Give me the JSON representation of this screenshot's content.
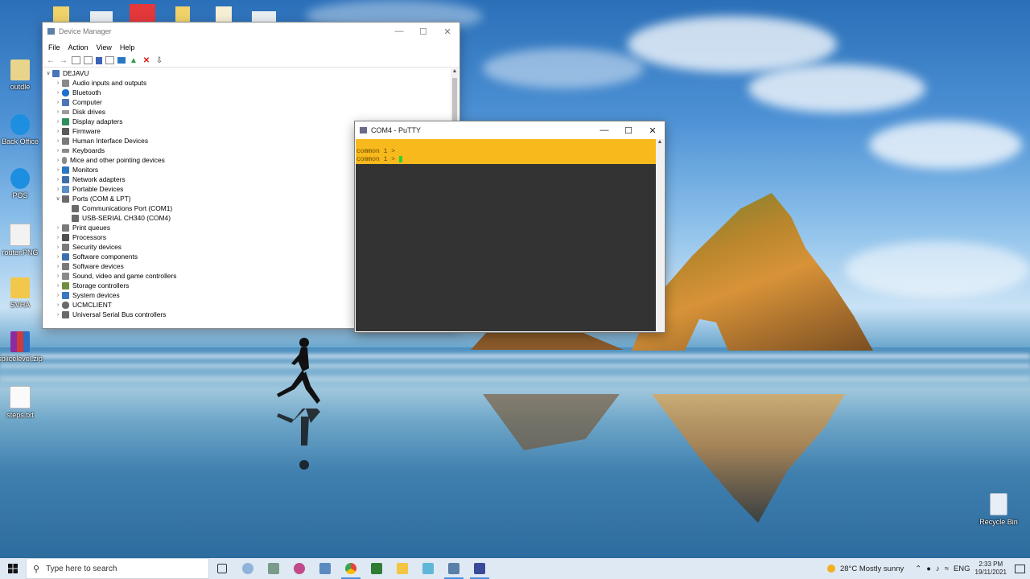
{
  "desktop_icons": [
    {
      "label": "outdle"
    },
    {
      "label": "Back Office"
    },
    {
      "label": "POS"
    },
    {
      "label": "router.PNG"
    },
    {
      "label": "SVHA"
    },
    {
      "label": "splicelevel.zip"
    },
    {
      "label": "steps.txt"
    },
    {
      "label": "Recycle Bin"
    }
  ],
  "device_manager": {
    "title": "Device Manager",
    "menu": [
      "File",
      "Action",
      "View",
      "Help"
    ],
    "root": "DEJAVU",
    "items": [
      {
        "label": "Audio inputs and outputs",
        "expanded": false
      },
      {
        "label": "Bluetooth",
        "expanded": false
      },
      {
        "label": "Computer",
        "expanded": false
      },
      {
        "label": "Disk drives",
        "expanded": false
      },
      {
        "label": "Display adapters",
        "expanded": false
      },
      {
        "label": "Firmware",
        "expanded": false
      },
      {
        "label": "Human Interface Devices",
        "expanded": false
      },
      {
        "label": "Keyboards",
        "expanded": false
      },
      {
        "label": "Mice and other pointing devices",
        "expanded": false
      },
      {
        "label": "Monitors",
        "expanded": false
      },
      {
        "label": "Network adapters",
        "expanded": false
      },
      {
        "label": "Portable Devices",
        "expanded": false
      },
      {
        "label": "Ports (COM & LPT)",
        "expanded": true
      },
      {
        "label": "Communications Port (COM1)",
        "child": true
      },
      {
        "label": "USB-SERIAL CH340 (COM4)",
        "child": true
      },
      {
        "label": "Print queues",
        "expanded": false
      },
      {
        "label": "Processors",
        "expanded": false
      },
      {
        "label": "Security devices",
        "expanded": false
      },
      {
        "label": "Software components",
        "expanded": false
      },
      {
        "label": "Software devices",
        "expanded": false
      },
      {
        "label": "Sound, video and game controllers",
        "expanded": false
      },
      {
        "label": "Storage controllers",
        "expanded": false
      },
      {
        "label": "System devices",
        "expanded": false
      },
      {
        "label": "UCMCLIENT",
        "expanded": false
      },
      {
        "label": "Universal Serial Bus controllers",
        "expanded": false
      }
    ]
  },
  "putty": {
    "title": "COM4 - PuTTY",
    "lines": [
      "common 1 >",
      "common 1 >"
    ]
  },
  "taskbar": {
    "search_placeholder": "Type here to search",
    "weather": "28°C  Mostly sunny",
    "language": "ENG",
    "time": "2:33 PM",
    "date": "19/11/2021"
  },
  "colors": {
    "putty_band": "#f7b91c",
    "terminal_bg": "#333333",
    "taskbar": "#dfe9f3"
  }
}
